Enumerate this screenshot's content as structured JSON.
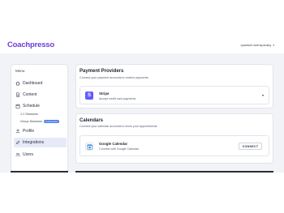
{
  "header": {
    "logo": "Coachpresso",
    "user": "quantum-twenty.dusky"
  },
  "sidebar": {
    "menu_title": "Menu",
    "items": [
      {
        "label": "Dashboard",
        "icon": "home-icon"
      },
      {
        "label": "Content",
        "icon": "document-icon"
      },
      {
        "label": "Schedule",
        "icon": "calendar-icon"
      },
      {
        "label": "Profile",
        "icon": "person-icon"
      },
      {
        "label": "Integrations",
        "icon": "link-icon",
        "active": true
      },
      {
        "label": "Users",
        "icon": "users-icon"
      }
    ],
    "sub_items": [
      {
        "label": "1:1 Sessions"
      },
      {
        "label": "Group Sessions",
        "badge": "Coming Soon"
      }
    ]
  },
  "payment": {
    "title": "Payment Providers",
    "subtitle": "Connect your payment accounts to receive payments",
    "provider": {
      "name": "Stripe",
      "desc": "Accept credit card payments",
      "icon_letter": "S"
    }
  },
  "calendars": {
    "title": "Calendars",
    "subtitle": "Connect your calendar accounts to show your appointments",
    "provider": {
      "name": "Google Calendar",
      "desc": "Connect with Google Calendar",
      "button": "CONNECT"
    }
  },
  "colors": {
    "brand": "#6b3fd4",
    "active_bg": "#e6eaf8",
    "stripe": "#635bff"
  }
}
